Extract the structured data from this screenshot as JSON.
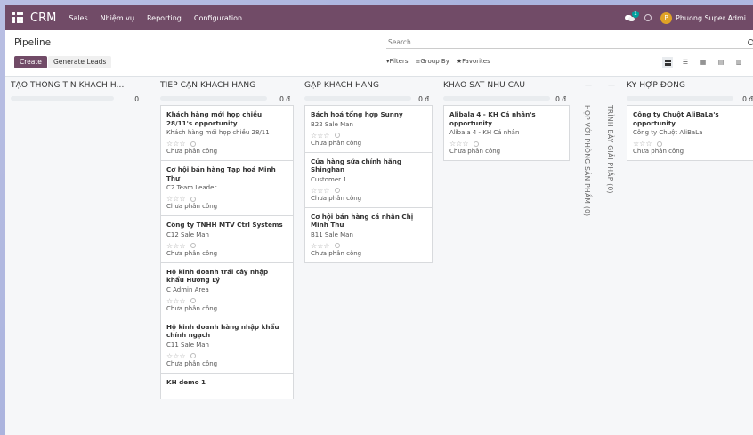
{
  "navbar": {
    "brand": "CRM",
    "menu": [
      "Sales",
      "Nhiệm vụ",
      "Reporting",
      "Configuration"
    ],
    "message_count": "1",
    "avatar_initial": "P",
    "user_name": "Phuong Super Admi"
  },
  "control": {
    "title": "Pipeline",
    "create_label": "Create",
    "generate_label": "Generate Leads",
    "search_placeholder": "Search...",
    "filters_label": "Filters",
    "groupby_label": "Group By",
    "favorites_label": "Favorites"
  },
  "columns": [
    {
      "title": "TẠO THÔNG TIN KHÁCH H...",
      "amount": "0",
      "cards": []
    },
    {
      "title": "TIẾP CẬN KHÁCH HÀNG",
      "amount": "0 đ",
      "cards": [
        {
          "name": "Khách hàng mới họp chiều 28/11's opportunity",
          "sub": "Khách hàng mới họp chiều 28/11",
          "assign": "Chưa phân công"
        },
        {
          "name": "Cơ hội bán hàng Tạp hoá Minh Thư",
          "sub": "C2 Team Leader",
          "assign": "Chưa phân công"
        },
        {
          "name": "Công ty TNHH MTV Ctrl Systems",
          "sub": "C12 Sale Man",
          "assign": "Chưa phân công"
        },
        {
          "name": "Hộ kinh doanh trái cây nhập khẩu Hương Lý",
          "sub": "C Admin Area",
          "assign": "Chưa phân công"
        },
        {
          "name": "Hộ kinh doanh hàng nhập khẩu chính ngạch",
          "sub": "C11 Sale Man",
          "assign": "Chưa phân công"
        },
        {
          "name": "KH demo 1",
          "sub": "",
          "assign": ""
        }
      ]
    },
    {
      "title": "GẶP KHÁCH HÀNG",
      "amount": "0 đ",
      "cards": [
        {
          "name": "Bách hoá tổng hợp Sunny",
          "sub": "B22 Sale Man",
          "assign": "Chưa phân công"
        },
        {
          "name": "Cửa hàng sữa chính hãng Shinghan",
          "sub": "Customer 1",
          "assign": "Chưa phân công"
        },
        {
          "name": "Cơ hội bán hàng cá nhân Chị Minh Thư",
          "sub": "B11 Sale Man",
          "assign": "Chưa phân công"
        }
      ]
    },
    {
      "title": "KHẢO SÁT NHU CẦU",
      "amount": "0 đ",
      "cards": [
        {
          "name": "Alibala 4 - KH Cá nhân's opportunity",
          "sub": "Alibala 4 - KH Cá nhân",
          "assign": "Chưa phân công"
        }
      ]
    }
  ],
  "folded": [
    {
      "label": "HỌP VỚI PHÒNG SẢN PHẨM (0)"
    },
    {
      "label": "TRÌNH BÀY GIẢI PHÁP (0)"
    }
  ],
  "last_column": {
    "title": "KÝ HỢP ĐỒNG",
    "amount": "0 đ",
    "cards": [
      {
        "name": "Công ty Chuột AliBaLa's opportunity",
        "sub": "Công ty Chuột AliBaLa",
        "assign": "Chưa phân công"
      }
    ]
  },
  "colors": {
    "brand": "#714b67",
    "avatar": "#e0a226",
    "badge": "#00a09d"
  }
}
